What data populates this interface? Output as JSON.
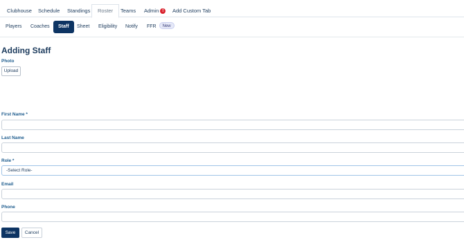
{
  "top_tabs": [
    "Clubhouse",
    "Schedule",
    "Standings",
    "Roster",
    "Teams",
    "Admin",
    "Add Custom Tab"
  ],
  "top_tabs_active": "Roster",
  "admin_alert": "!",
  "sub_tabs": [
    "Players",
    "Coaches",
    "Staff",
    "Sheet",
    "Eligibility",
    "Notify",
    "FFR"
  ],
  "sub_tabs_active": "Staff",
  "ffr_badge": "New",
  "page_title": "Adding Staff",
  "photo": {
    "label": "Photo",
    "upload_label": "Upload"
  },
  "form": {
    "first_name_label": "First Name *",
    "first_name_value": "",
    "last_name_label": "Last Name",
    "last_name_value": "",
    "role_label": "Role *",
    "role_selected": "-Select Role-",
    "email_label": "Email",
    "email_value": "",
    "phone_label": "Phone",
    "phone_value": ""
  },
  "actions": {
    "save_label": "Save",
    "cancel_label": "Cancel"
  },
  "colors": {
    "primary": "#0d3463",
    "label": "#1b5a8c",
    "alert": "#d9232e"
  }
}
